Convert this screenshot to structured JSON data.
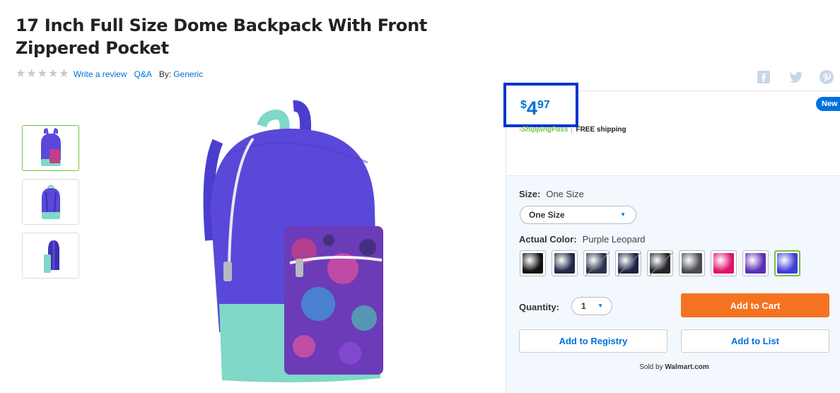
{
  "product": {
    "title": "17 Inch Full Size Dome Backpack With Front Zippered Pocket",
    "rating_stars": 0,
    "write_review": "Write a review",
    "qa": "Q&A",
    "by_label": "By:",
    "brand": "Generic"
  },
  "social": [
    "facebook-icon",
    "twitter-icon",
    "pinterest-icon"
  ],
  "colors": {
    "brand_blue": "#0071dc",
    "cart_orange": "#f47321",
    "selected_green": "#76c043",
    "highlight_box": "#0034d0",
    "backpack_purple": "#5a48d9",
    "backpack_mint": "#7fd8c8"
  },
  "price": {
    "symbol": "$",
    "dollars": "4",
    "cents": "97",
    "badge": "New"
  },
  "shipping": {
    "program": "ShippingPass",
    "text": "FREE shipping"
  },
  "size": {
    "label": "Size:",
    "value": "One Size",
    "selected_option": "One Size"
  },
  "color": {
    "label": "Actual Color:",
    "value": "Purple Leopard",
    "swatches": [
      {
        "name": "black",
        "color": "#111111",
        "unavailable": false
      },
      {
        "name": "navy",
        "color": "#1f2a4a",
        "unavailable": false
      },
      {
        "name": "navy-gray",
        "color": "#2b3350",
        "unavailable": true
      },
      {
        "name": "navy-dark",
        "color": "#1c2448",
        "unavailable": true
      },
      {
        "name": "black-gray",
        "color": "#222428",
        "unavailable": true
      },
      {
        "name": "gray",
        "color": "#4a4c52",
        "unavailable": false
      },
      {
        "name": "pink",
        "color": "#e0106a",
        "unavailable": false
      },
      {
        "name": "purple",
        "color": "#5a2fb8",
        "unavailable": false
      },
      {
        "name": "purple-leopard",
        "color": "#3f3ed6",
        "unavailable": false,
        "selected": true
      }
    ]
  },
  "quantity": {
    "label": "Quantity:",
    "value": "1"
  },
  "buttons": {
    "add_to_cart": "Add to Cart",
    "add_to_registry": "Add to Registry",
    "add_to_list": "Add to List"
  },
  "seller": {
    "prefix": "Sold by",
    "name": "Walmart.com"
  }
}
